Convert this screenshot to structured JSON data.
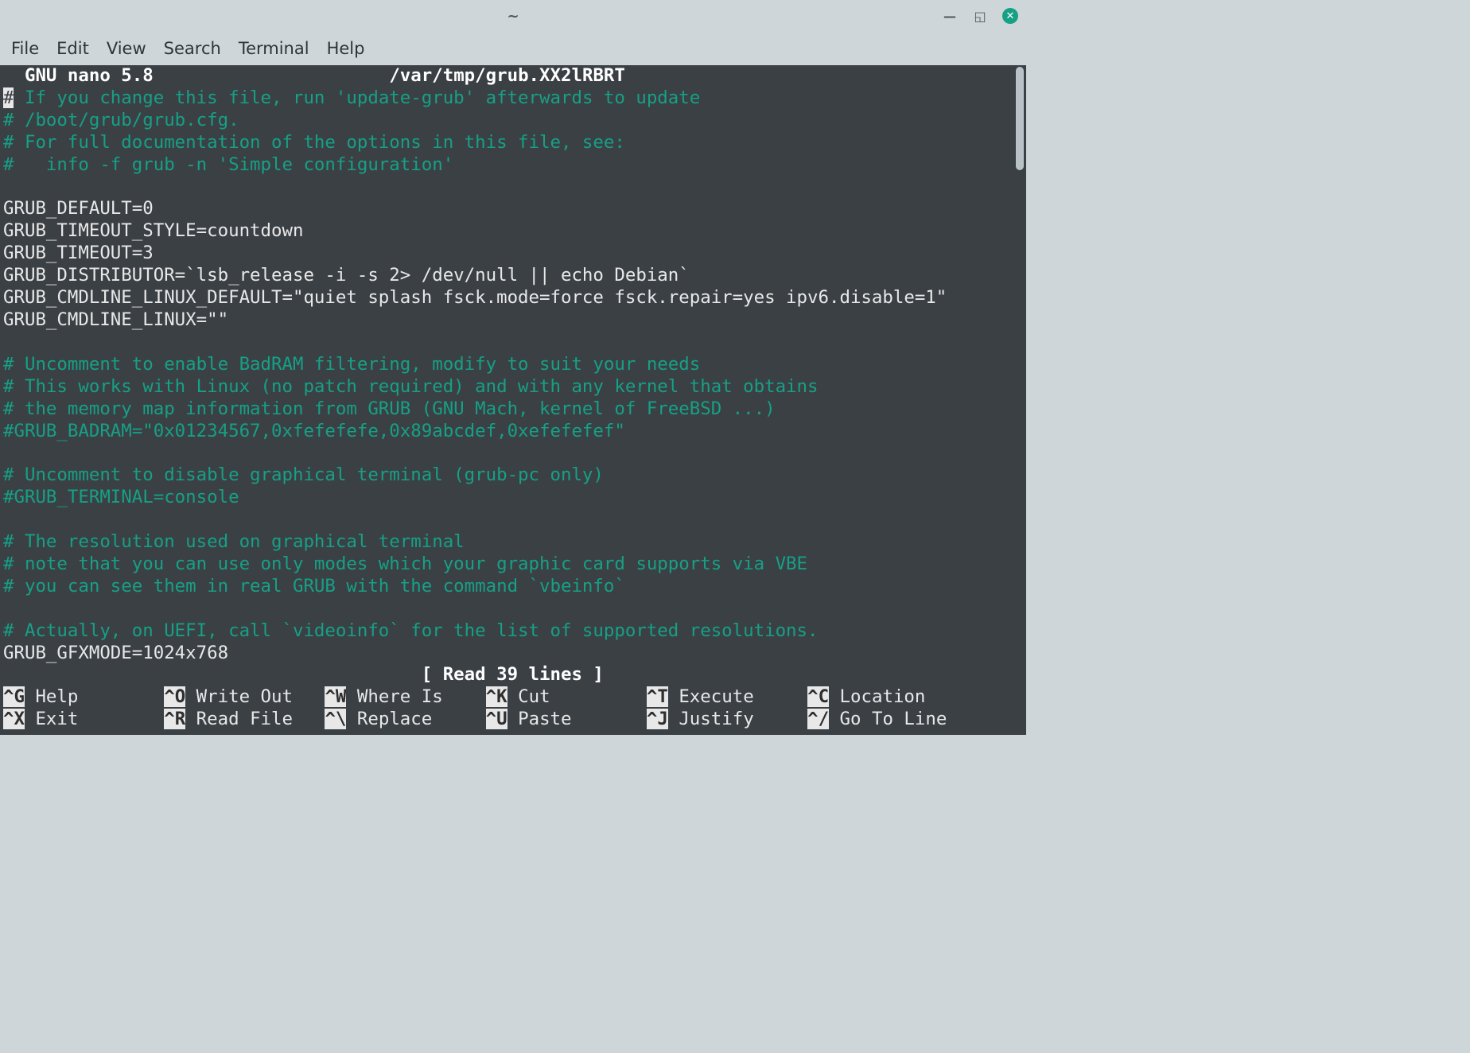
{
  "window": {
    "title": "~",
    "controls": {
      "minimize": "—",
      "maximize": "◱",
      "close": "✕"
    }
  },
  "menubar": {
    "items": [
      "File",
      "Edit",
      "View",
      "Search",
      "Terminal",
      "Help"
    ]
  },
  "nano": {
    "header_left": "  GNU nano 5.8",
    "header_file": "/var/tmp/grub.XX2lRBRT",
    "status": "[ Read 39 lines ]",
    "lines": [
      {
        "cursor": "#",
        "text": " If you change this file, run 'update-grub' afterwards to update",
        "cls": "cmt"
      },
      {
        "text": "# /boot/grub/grub.cfg.",
        "cls": "cmt"
      },
      {
        "text": "# For full documentation of the options in this file, see:",
        "cls": "cmt"
      },
      {
        "text": "#   info -f grub -n 'Simple configuration'",
        "cls": "cmt"
      },
      {
        "text": "",
        "cls": "plain"
      },
      {
        "text": "GRUB_DEFAULT=0",
        "cls": "plain"
      },
      {
        "text": "GRUB_TIMEOUT_STYLE=countdown",
        "cls": "plain"
      },
      {
        "text": "GRUB_TIMEOUT=3",
        "cls": "plain"
      },
      {
        "text": "GRUB_DISTRIBUTOR=`lsb_release -i -s 2> /dev/null || echo Debian`",
        "cls": "plain"
      },
      {
        "text": "GRUB_CMDLINE_LINUX_DEFAULT=\"quiet splash fsck.mode=force fsck.repair=yes ipv6.disable=1\"",
        "cls": "plain"
      },
      {
        "text": "GRUB_CMDLINE_LINUX=\"\"",
        "cls": "plain"
      },
      {
        "text": "",
        "cls": "plain"
      },
      {
        "text": "# Uncomment to enable BadRAM filtering, modify to suit your needs",
        "cls": "cmt"
      },
      {
        "text": "# This works with Linux (no patch required) and with any kernel that obtains",
        "cls": "cmt"
      },
      {
        "text": "# the memory map information from GRUB (GNU Mach, kernel of FreeBSD ...)",
        "cls": "cmt"
      },
      {
        "text": "#GRUB_BADRAM=\"0x01234567,0xfefefefe,0x89abcdef,0xefefefef\"",
        "cls": "cmt"
      },
      {
        "text": "",
        "cls": "plain"
      },
      {
        "text": "# Uncomment to disable graphical terminal (grub-pc only)",
        "cls": "cmt"
      },
      {
        "text": "#GRUB_TERMINAL=console",
        "cls": "cmt"
      },
      {
        "text": "",
        "cls": "plain"
      },
      {
        "text": "# The resolution used on graphical terminal",
        "cls": "cmt"
      },
      {
        "text": "# note that you can use only modes which your graphic card supports via VBE",
        "cls": "cmt"
      },
      {
        "text": "# you can see them in real GRUB with the command `vbeinfo`",
        "cls": "cmt"
      },
      {
        "text": "",
        "cls": "plain"
      },
      {
        "text": "# Actually, on UEFI, call `videoinfo` for the list of supported resolutions.",
        "cls": "cmt"
      },
      {
        "text": "GRUB_GFXMODE=1024x768",
        "cls": "plain"
      }
    ],
    "shortcuts": {
      "row1": [
        {
          "key": "^G",
          "label": "Help"
        },
        {
          "key": "^O",
          "label": "Write Out"
        },
        {
          "key": "^W",
          "label": "Where Is"
        },
        {
          "key": "^K",
          "label": "Cut"
        },
        {
          "key": "^T",
          "label": "Execute"
        },
        {
          "key": "^C",
          "label": "Location"
        }
      ],
      "row2": [
        {
          "key": "^X",
          "label": "Exit"
        },
        {
          "key": "^R",
          "label": "Read File"
        },
        {
          "key": "^\\",
          "label": "Replace"
        },
        {
          "key": "^U",
          "label": "Paste"
        },
        {
          "key": "^J",
          "label": "Justify"
        },
        {
          "key": "^/",
          "label": "Go To Line"
        }
      ]
    }
  }
}
